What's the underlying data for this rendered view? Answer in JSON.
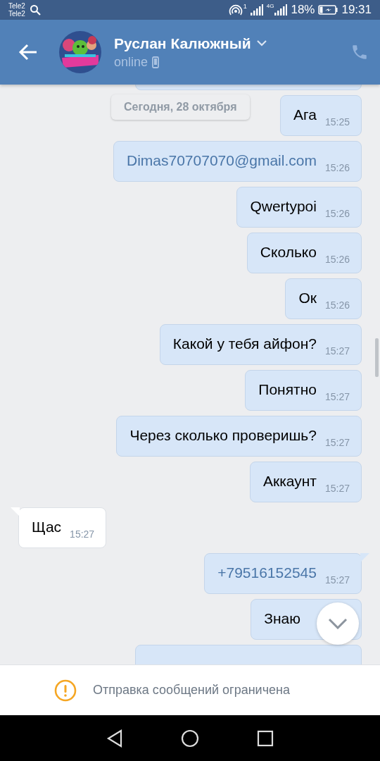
{
  "status_bar": {
    "carriers": [
      "Tele2",
      "Tele2"
    ],
    "hotspot_count": "1",
    "network": "4G",
    "battery": "18%",
    "time": "19:31"
  },
  "header": {
    "name": "Руслан Калюжный",
    "status": "online"
  },
  "date_chip": "Сегодня, 28 октября",
  "messages": [
    {
      "kind": "cut"
    },
    {
      "kind": "out",
      "text": "Ага",
      "time": "15:25",
      "link": false,
      "tail": false
    },
    {
      "kind": "out",
      "text": "Dimas70707070@gmail.com",
      "time": "15:26",
      "link": true,
      "tail": false
    },
    {
      "kind": "out",
      "text": "Qwertypoi",
      "time": "15:26",
      "link": false,
      "tail": false
    },
    {
      "kind": "out",
      "text": "Сколько",
      "time": "15:26",
      "link": false,
      "tail": false
    },
    {
      "kind": "out",
      "text": "Ок",
      "time": "15:26",
      "link": false,
      "tail": false
    },
    {
      "kind": "out",
      "text": "Какой у тебя айфон?",
      "time": "15:27",
      "link": false,
      "tail": false
    },
    {
      "kind": "out",
      "text": "Понятно",
      "time": "15:27",
      "link": false,
      "tail": false
    },
    {
      "kind": "out",
      "text": "Через сколько проверишь?",
      "time": "15:27",
      "link": false,
      "tail": false
    },
    {
      "kind": "out",
      "text": "Аккаунт",
      "time": "15:27",
      "link": false,
      "tail": false
    },
    {
      "kind": "in",
      "text": "Щас",
      "time": "15:27",
      "link": false,
      "tail": true
    },
    {
      "kind": "out",
      "text": "+79516152545",
      "time": "15:27",
      "link": true,
      "tail": true
    },
    {
      "kind": "out",
      "text": "Знаю",
      "link": false,
      "tail": false
    },
    {
      "kind": "cut"
    }
  ],
  "notice": "Отправка сообщений ограничена"
}
